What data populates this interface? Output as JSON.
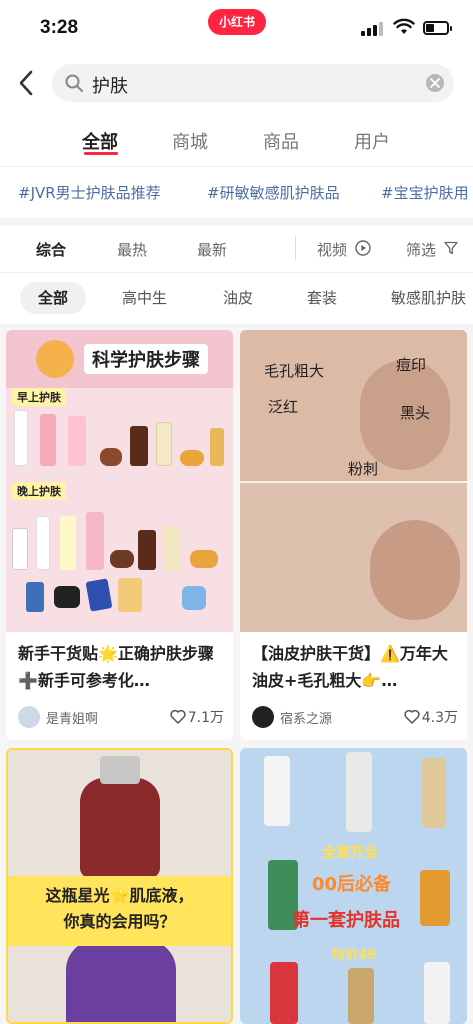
{
  "status_bar": {
    "time": "3:28",
    "app_badge": "小红书",
    "battery_level": 0.4
  },
  "search": {
    "query": "护肤"
  },
  "tabs": [
    {
      "label": "全部",
      "active": true
    },
    {
      "label": "商城",
      "active": false
    },
    {
      "label": "商品",
      "active": false
    },
    {
      "label": "用户",
      "active": false
    }
  ],
  "hashtags": [
    "#JVR男士护肤品推荐",
    "#研敏敏感肌护肤品",
    "#宝宝护肤用"
  ],
  "filters": {
    "sort": [
      {
        "label": "综合",
        "active": true
      },
      {
        "label": "最热",
        "active": false
      },
      {
        "label": "最新",
        "active": false
      }
    ],
    "video_label": "视频",
    "filter_label": "筛选"
  },
  "chips": [
    {
      "label": "全部",
      "active": true
    },
    {
      "label": "高中生",
      "active": false
    },
    {
      "label": "油皮",
      "active": false
    },
    {
      "label": "套装",
      "active": false
    },
    {
      "label": "敏感肌护肤",
      "active": false
    }
  ],
  "cards": [
    {
      "image_texts": {
        "headline": "科学护肤步骤",
        "morning": "早上护肤",
        "evening": "晚上护肤"
      },
      "title": "新手干货贴🌟正确护肤步骤➕新手可参考化…",
      "author": "是青姐啊",
      "likes": "7.1万"
    },
    {
      "image_texts": {
        "l1": "毛孔粗大",
        "l2": "痘印",
        "l3": "泛红",
        "l4": "黑头",
        "l5": "粉刺"
      },
      "title": "【油皮护肤干货】⚠️万年大油皮+毛孔粗大👉…",
      "author": "宿系之源",
      "likes": "4.3万"
    },
    {
      "image_texts": {
        "line1": "这瓶星光⭐肌底液，",
        "line2": "你真的会用吗？"
      }
    },
    {
      "image_texts": {
        "line1": "全套齐全",
        "line2": "00后必备",
        "line3": "第一套护肤品",
        "line4": "均价49"
      }
    }
  ],
  "colors": {
    "brand": "#ff2442",
    "hashtag": "#4a6fa5"
  }
}
